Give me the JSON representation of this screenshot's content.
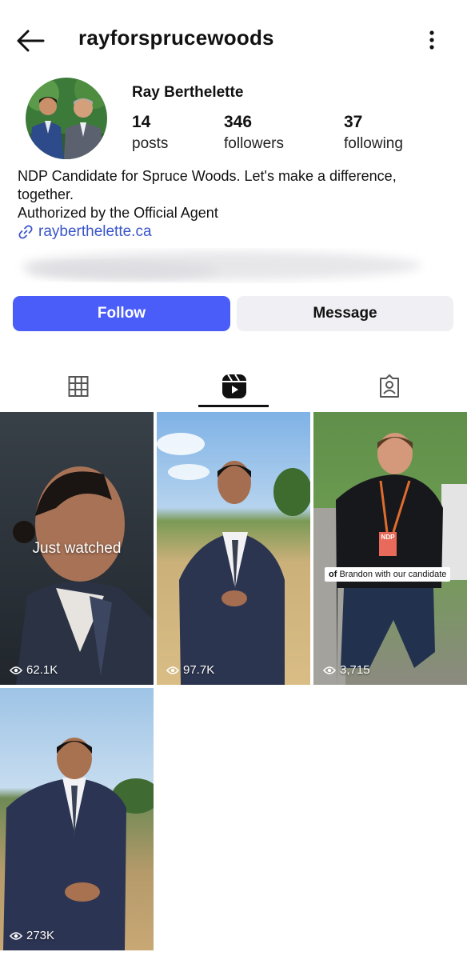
{
  "header": {
    "username": "rayforsprucewoods"
  },
  "profile": {
    "name": "Ray Berthelette",
    "stats": [
      {
        "value": "14",
        "label": "posts"
      },
      {
        "value": "346",
        "label": "followers"
      },
      {
        "value": "37",
        "label": "following"
      }
    ],
    "bio_line1": "NDP Candidate for Spruce Woods. Let's make a difference,",
    "bio_line2": "together.",
    "bio_line3": "Authorized by the Official Agent",
    "link": "rayberthelette.ca"
  },
  "buttons": {
    "follow": "Follow",
    "message": "Message"
  },
  "tabs": [
    "grid-icon",
    "reels-icon",
    "tagged-icon"
  ],
  "colors": {
    "follow_bg": "#4a5df9",
    "link": "#3a55c9",
    "message_bg": "#efeff4"
  },
  "reels": [
    {
      "views": "62.1K",
      "overlay": "Just watched"
    },
    {
      "views": "97.7K"
    },
    {
      "views": "3,715",
      "caption_bold": "of",
      "caption": " Brandon with our candidate",
      "badge": "NDP"
    },
    {
      "views": "273K"
    }
  ]
}
